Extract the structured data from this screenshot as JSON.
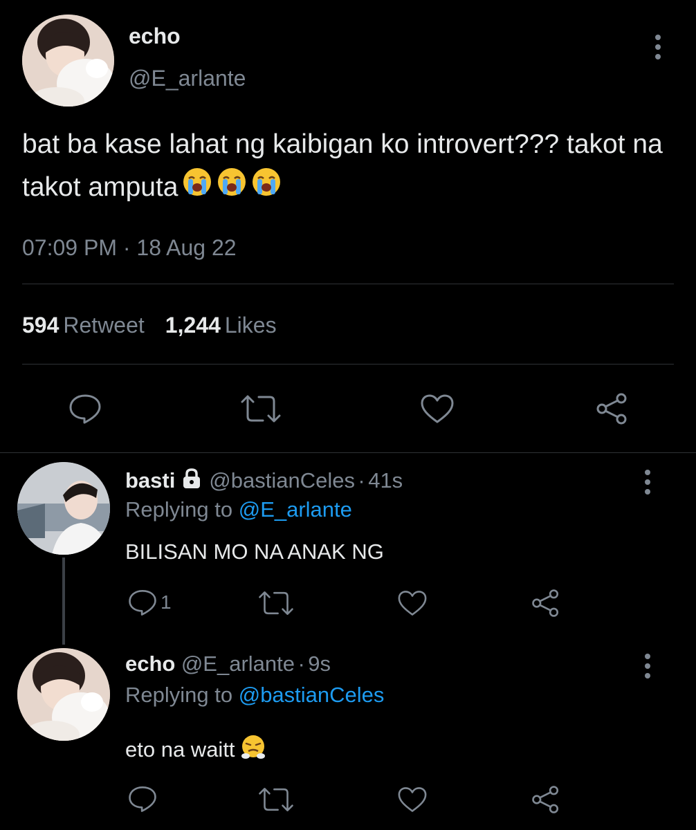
{
  "main_tweet": {
    "author_name": "echo",
    "author_handle": "@E_arlante",
    "text": "bat ba kase lahat ng kaibigan ko introvert??? takot na takot amputa",
    "text_emojis": [
      "loudly-crying-face",
      "loudly-crying-face",
      "loudly-crying-face"
    ],
    "time": "07:09 PM",
    "separator": "·",
    "date": "18 Aug 22",
    "retweet_count": "594",
    "retweet_label": "Retweet",
    "like_count": "1,244",
    "like_label": "Likes",
    "actions": [
      "reply-icon",
      "retweet-icon",
      "like-icon",
      "share-icon"
    ]
  },
  "replies": [
    {
      "author_name": "basti",
      "locked_icon": "lock-icon",
      "author_handle": "@bastianCeles",
      "dot": "·",
      "time_ago": "41s",
      "replying_prefix": "Replying to",
      "replying_to": "@E_arlante",
      "text": "BILISAN MO NA ANAK NG",
      "reply_count": "1"
    },
    {
      "author_name": "echo",
      "author_handle": "@E_arlante",
      "dot": "·",
      "time_ago": "9s",
      "replying_prefix": "Replying to",
      "replying_to": "@bastianCeles",
      "text": "eto na waitt",
      "text_emoji": "face-with-steam-from-nose"
    }
  ],
  "colors": {
    "background": "#000000",
    "primary_text": "#e7e9ea",
    "secondary_text": "#7f8893",
    "link": "#1d9bf0",
    "divider": "#2f3336"
  }
}
